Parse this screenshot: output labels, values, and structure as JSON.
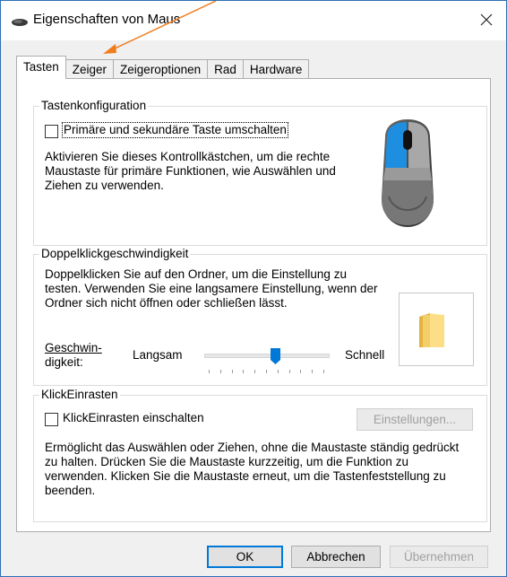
{
  "window": {
    "title": "Eigenschaften von Maus"
  },
  "tabs": [
    {
      "label": "Tasten",
      "active": true
    },
    {
      "label": "Zeiger"
    },
    {
      "label": "Zeigeroptionen"
    },
    {
      "label": "Rad"
    },
    {
      "label": "Hardware"
    }
  ],
  "button_config": {
    "group_title": "Tastenkonfiguration",
    "checkbox_label": "Primäre und sekundäre Taste umschalten",
    "checked": false,
    "description": "Aktivieren Sie dieses Kontrollkästchen, um die rechte Maustaste für primäre Funktionen, wie Auswählen und Ziehen zu verwenden."
  },
  "double_click": {
    "group_title": "Doppelklickgeschwindigkeit",
    "description": "Doppelklicken Sie auf den Ordner, um die Einstellung zu testen. Verwenden Sie eine langsamere Einstellung, wenn der Ordner sich nicht öffnen oder schließen lässt.",
    "speed_label_line1": "Geschwin-",
    "speed_label_line2": "digkeit:",
    "slow_label": "Langsam",
    "fast_label": "Schnell",
    "slider_value": 0.58,
    "tick_count": 11
  },
  "click_lock": {
    "group_title": "KlickEinrasten",
    "checkbox_label": "KlickEinrasten einschalten",
    "checked": false,
    "settings_button": "Einstellungen...",
    "description": "Ermöglicht das Auswählen oder Ziehen, ohne die Maustaste ständig gedrückt zu halten. Drücken Sie die Maustaste kurzzeitig, um die Funktion zu verwenden. Klicken Sie die Maustaste erneut, um die Tastenfeststellung zu beenden."
  },
  "footer": {
    "ok": "OK",
    "cancel": "Abbrechen",
    "apply": "Übernehmen"
  },
  "colors": {
    "accent": "#0078d7",
    "annotation_arrow": "#f07c1c",
    "border": "#adadad"
  }
}
